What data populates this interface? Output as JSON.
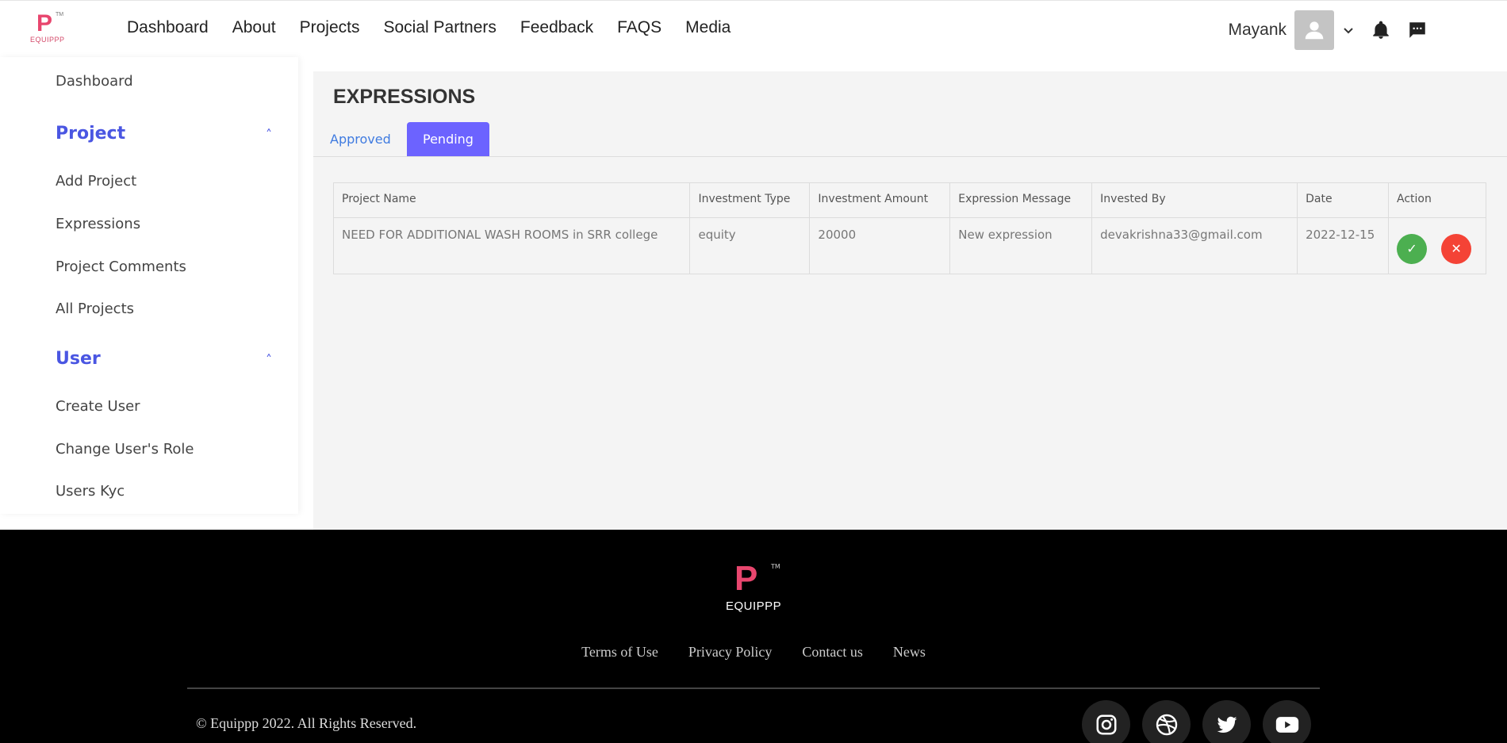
{
  "header": {
    "logo_text": "EQUIPPP",
    "nav": [
      "Dashboard",
      "About",
      "Projects",
      "Social Partners",
      "Feedback",
      "FAQS",
      "Media"
    ],
    "user_name": "Mayank"
  },
  "sidebar": {
    "dashboard": "Dashboard",
    "project_section": "Project",
    "project_items": [
      "Add Project",
      "Expressions",
      "Project Comments",
      "All Projects"
    ],
    "user_section": "User",
    "user_items": [
      "Create User",
      "Change User's Role",
      "Users Kyc"
    ],
    "caret": "˄"
  },
  "main": {
    "title": "EXPRESSIONS",
    "tabs": [
      "Approved",
      "Pending"
    ],
    "active_tab": "Pending",
    "table": {
      "headers": [
        "Project Name",
        "Investment Type",
        "Investment Amount",
        "Expression Message",
        "Invested By",
        "Date",
        "Action"
      ],
      "rows": [
        [
          "NEED FOR ADDITIONAL WASH ROOMS in SRR college",
          "equity",
          "20000",
          "New expression",
          "devakrishna33@gmail.com",
          "2022-12-15"
        ]
      ]
    },
    "approve_glyph": "✓",
    "reject_glyph": "✕"
  },
  "footer": {
    "brand": "EQUIPPP",
    "tm": "TM",
    "links": [
      "Terms of Use",
      "Privacy Policy",
      "Contact us",
      "News"
    ],
    "copyright": "© Equippp 2022. All Rights Reserved.",
    "social": [
      "instagram-icon",
      "dribbble-icon",
      "twitter-icon",
      "youtube-icon"
    ]
  },
  "colors": {
    "accent": "#6c63ff",
    "section_blue": "#4a56e2",
    "approve": "#4caf50",
    "reject": "#f44336",
    "footer_bg": "#000000"
  }
}
